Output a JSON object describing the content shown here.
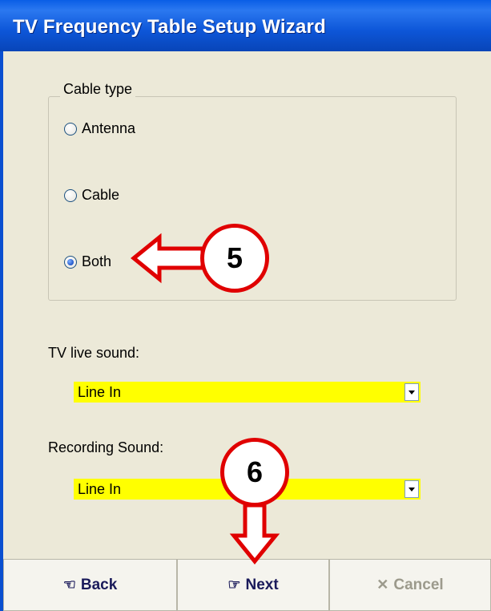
{
  "window": {
    "title": "TV Frequency Table Setup Wizard"
  },
  "cable_type": {
    "legend": "Cable type",
    "options": [
      {
        "label": "Antenna",
        "checked": false
      },
      {
        "label": "Cable",
        "checked": false
      },
      {
        "label": "Both",
        "checked": true
      }
    ]
  },
  "live_sound": {
    "label": "TV live sound:",
    "value": "Line In"
  },
  "recording_sound": {
    "label": "Recording Sound:",
    "value": "Line In"
  },
  "buttons": {
    "back": "Back",
    "next": "Next",
    "cancel": "Cancel"
  },
  "annotations": {
    "step5": "5",
    "step6": "6"
  },
  "colors": {
    "highlight": "#ffff00",
    "annotation": "#e00000",
    "titlebar": "#0a5ee6"
  }
}
